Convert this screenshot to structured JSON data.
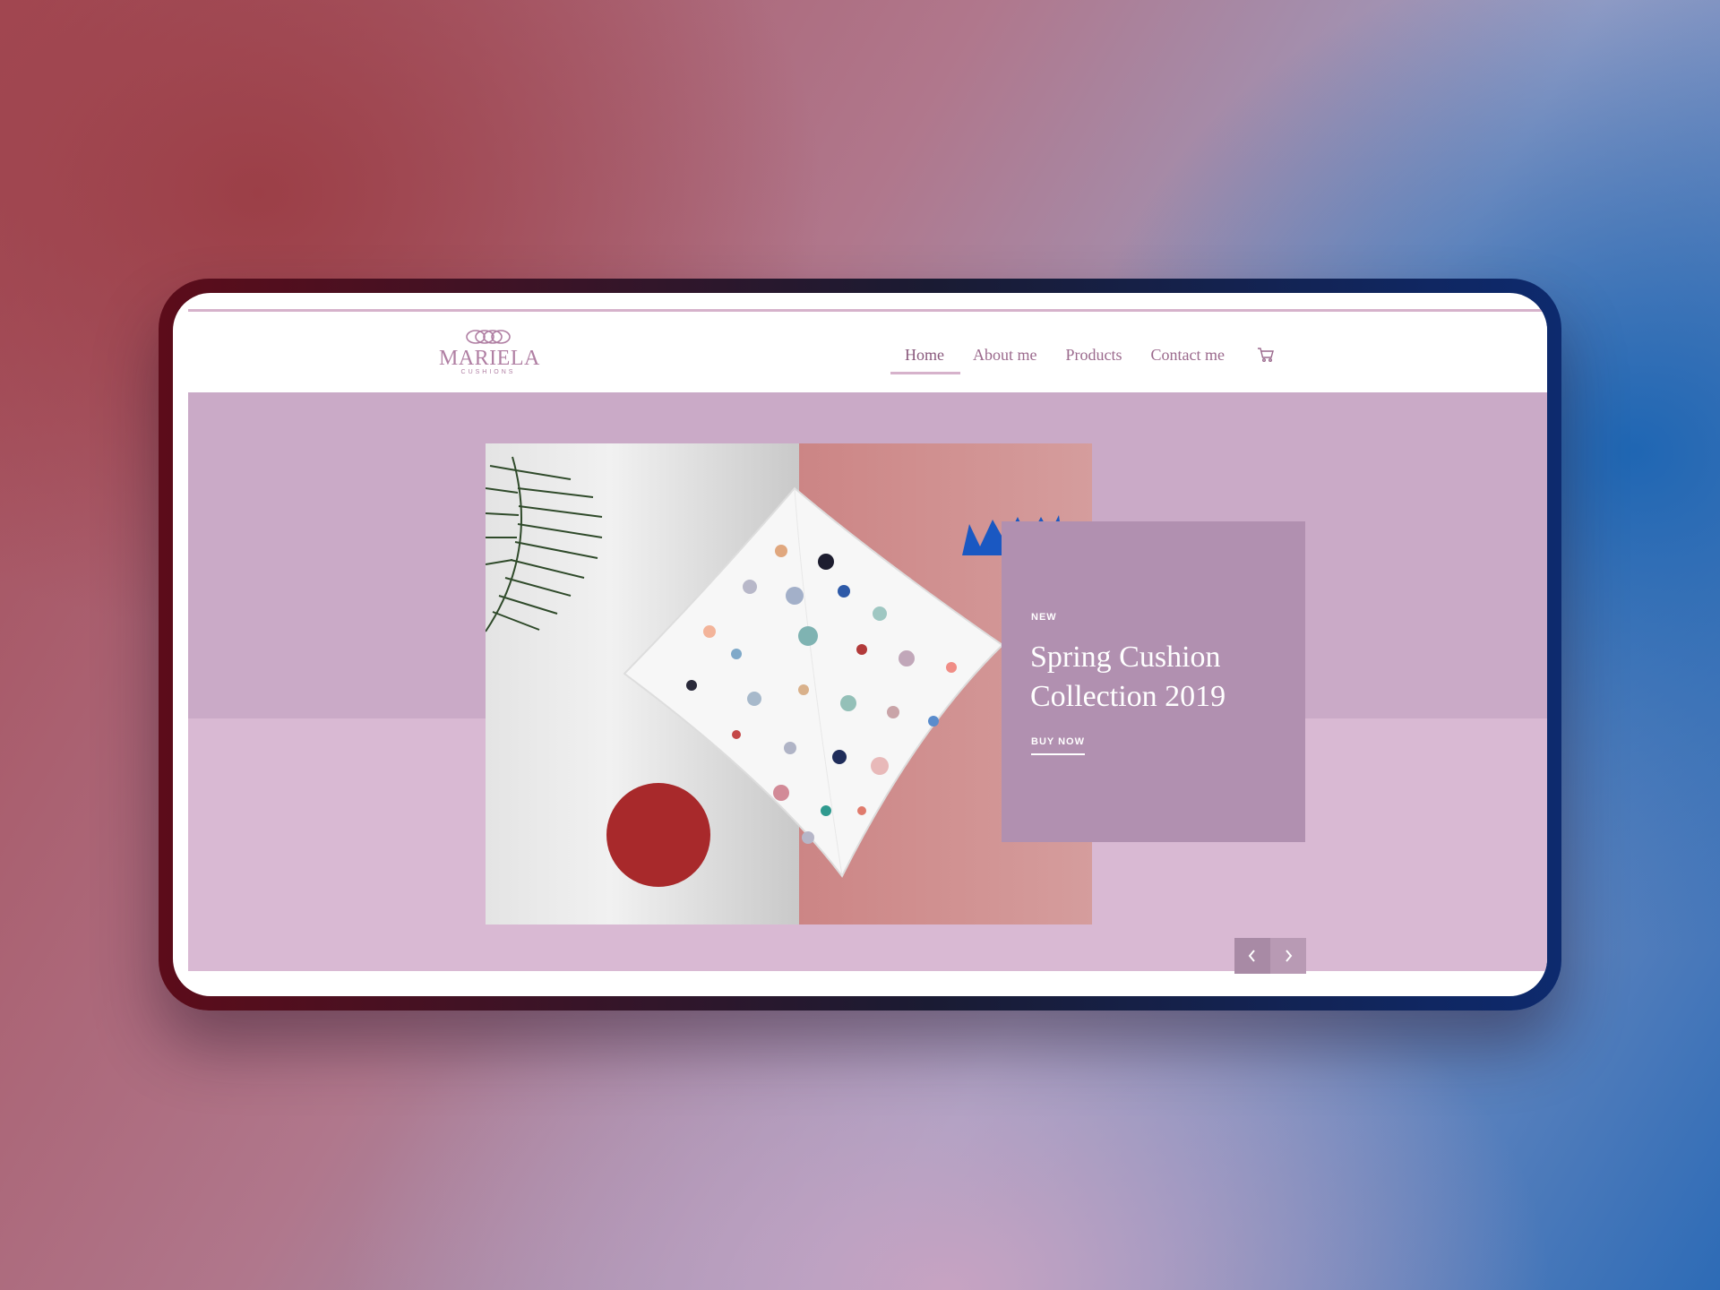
{
  "brand": {
    "name": "MARIELA",
    "tagline": "CUSHIONS"
  },
  "nav": {
    "items": [
      {
        "label": "Home",
        "active": true
      },
      {
        "label": "About me",
        "active": false
      },
      {
        "label": "Products",
        "active": false
      },
      {
        "label": "Contact me",
        "active": false
      }
    ],
    "cart_icon": "cart-icon"
  },
  "hero": {
    "tag": "NEW",
    "title": "Spring Cushion Collection 2019",
    "cta": "BUY NOW",
    "prev_icon": "chevron-left-icon",
    "next_icon": "chevron-right-icon"
  },
  "colors": {
    "accent": "#b07fa3",
    "hero_top": "#caaac7",
    "hero_bottom": "#d9b9d3",
    "promo_box": "#b190b0",
    "device_frame_left": "#5c0c1a",
    "device_frame_right": "#0d2a6e"
  }
}
